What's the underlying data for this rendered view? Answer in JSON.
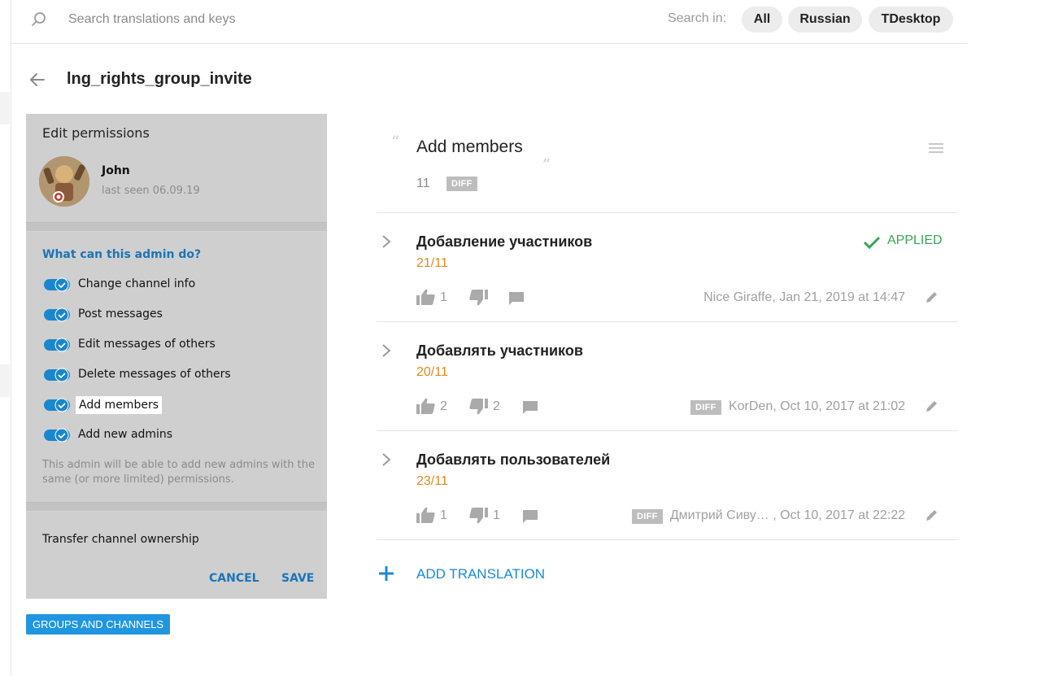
{
  "search": {
    "placeholder": "Search translations and keys",
    "search_in_label": "Search in:",
    "filters": [
      "All",
      "Russian",
      "TDesktop"
    ]
  },
  "key": {
    "name": "lng_rights_group_invite"
  },
  "screenshot": {
    "header": "Edit permissions",
    "user_name": "John",
    "last_seen": "last seen 06.09.19",
    "section_title": "What can this admin do?",
    "permissions": [
      "Change channel info",
      "Post messages",
      "Edit messages of others",
      "Delete messages of others",
      "Add members",
      "Add new admins"
    ],
    "note": "This admin will be able to add new admins with the same (or more limited) permissions.",
    "transfer": "Transfer channel ownership",
    "cancel": "CANCEL",
    "save": "SAVE"
  },
  "tag": "GROUPS AND CHANNELS",
  "source": {
    "text": "Add members",
    "char_count": "11",
    "diff": "DIFF"
  },
  "translations": [
    {
      "text": "Добавление участников",
      "count": "21/11",
      "likes": "1",
      "dislikes": "",
      "status": "APPLIED",
      "author": "Nice Giraffe, Jan 21, 2019 at 14:47",
      "diff": ""
    },
    {
      "text": "Добавлять участников",
      "count": "20/11",
      "likes": "2",
      "dislikes": "2",
      "status": "",
      "author": "KorDen, Oct 10, 2017 at 21:02",
      "diff": "DIFF"
    },
    {
      "text": "Добавлять пользователей",
      "count": "23/11",
      "likes": "1",
      "dislikes": "1",
      "status": "",
      "author": "Дмитрий Сиву… , Oct 10, 2017 at 22:22",
      "diff": "DIFF"
    }
  ],
  "add_translation": "ADD TRANSLATION",
  "colors": {
    "accent": "#1a8ad4",
    "applied": "#3aa357",
    "count": "#e08a1e",
    "tag": "#2196e0"
  }
}
